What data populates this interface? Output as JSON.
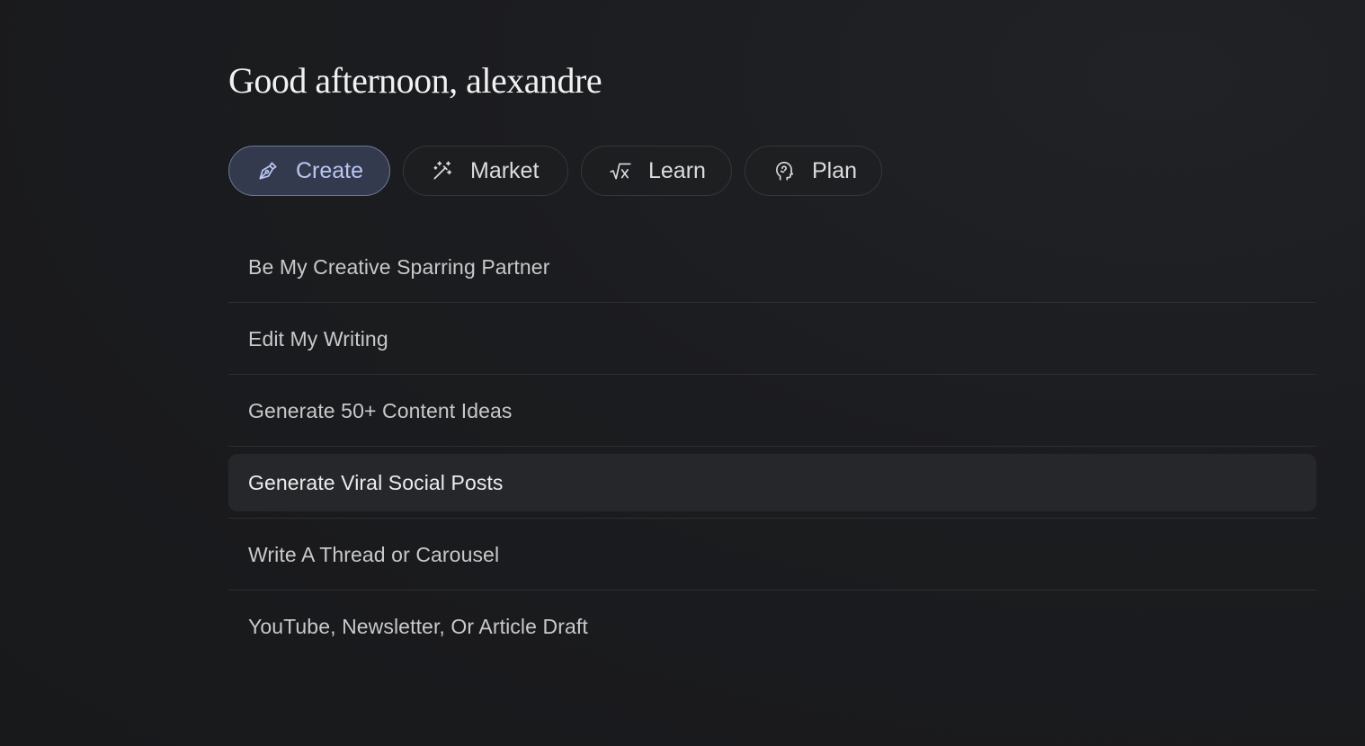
{
  "greeting": "Good afternoon, alexandre",
  "tabs": [
    {
      "label": "Create",
      "icon": "pen-icon",
      "active": true
    },
    {
      "label": "Market",
      "icon": "magic-wand-icon",
      "active": false
    },
    {
      "label": "Learn",
      "icon": "square-root-icon",
      "active": false
    },
    {
      "label": "Plan",
      "icon": "brain-head-icon",
      "active": false
    }
  ],
  "prompts": [
    {
      "label": "Be My Creative Sparring Partner"
    },
    {
      "label": "Edit My Writing"
    },
    {
      "label": "Generate 50+ Content Ideas"
    },
    {
      "label": "Generate Viral Social Posts",
      "highlighted": true
    },
    {
      "label": "Write A Thread or Carousel"
    },
    {
      "label": "YouTube, Newsletter, Or Article Draft"
    }
  ],
  "colors": {
    "background": "#1b1c1f",
    "active_tab_bg": "#343a4d",
    "active_tab_text": "#b9c6f2",
    "highlight_row": "#26272b"
  }
}
